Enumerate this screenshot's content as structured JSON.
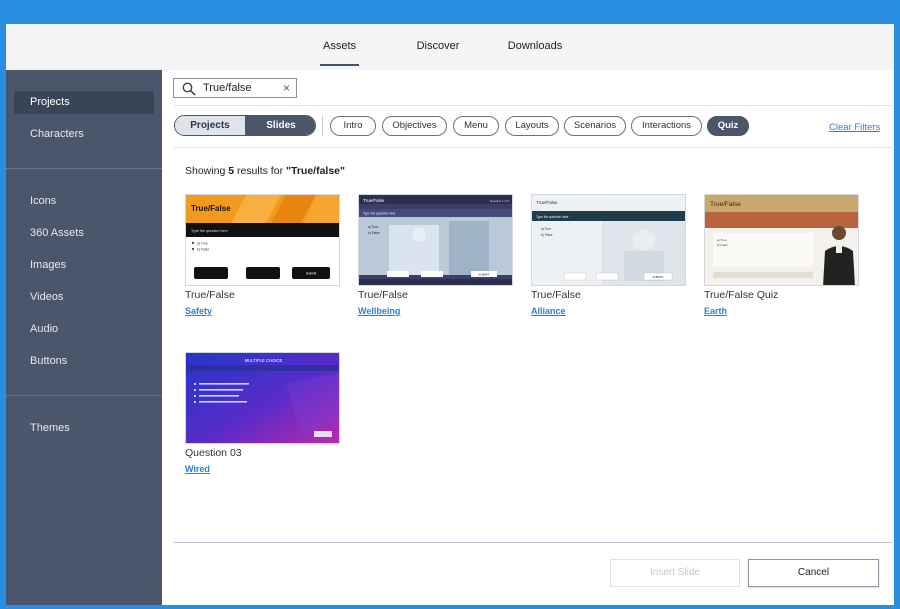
{
  "top_tabs": [
    {
      "label": "Assets",
      "active": true
    },
    {
      "label": "Discover",
      "active": false
    },
    {
      "label": "Downloads",
      "active": false
    }
  ],
  "sidebar": {
    "group1": [
      "Projects",
      "Characters"
    ],
    "group2": [
      "Icons",
      "360 Assets",
      "Images",
      "Videos",
      "Audio",
      "Buttons"
    ],
    "group3": [
      "Themes"
    ],
    "active": "Projects"
  },
  "search": {
    "value": "True/false",
    "icon": "search-icon",
    "clear_icon": "close-icon"
  },
  "segment": {
    "projects": "Projects",
    "slides": "Slides",
    "selected": "Slides"
  },
  "filters": [
    {
      "label": "Intro",
      "active": false
    },
    {
      "label": "Objectives",
      "active": false
    },
    {
      "label": "Menu",
      "active": false
    },
    {
      "label": "Layouts",
      "active": false
    },
    {
      "label": "Scenarios",
      "active": false
    },
    {
      "label": "Interactions",
      "active": false
    },
    {
      "label": "Quiz",
      "active": true
    }
  ],
  "clear_filters": "Clear Filters",
  "results": {
    "prefix": "Showing",
    "count": "5",
    "middle": "results for",
    "query": "\"True/false\""
  },
  "cards": [
    {
      "title": "True/False",
      "link": "Safety",
      "thumb": {
        "heading": "True/False",
        "question": "Type the question here",
        "options": [
          "a) True",
          "b) False"
        ],
        "submit": "Submit"
      }
    },
    {
      "title": "True/False",
      "link": "Wellbeing",
      "thumb": {
        "heading": "True/False",
        "counter": "Question 1 of 5",
        "question": "Type the question here",
        "options": [
          "a) True",
          "b) False"
        ],
        "submit": "SUBMIT"
      }
    },
    {
      "title": "True/False",
      "link": "Alliance",
      "thumb": {
        "heading": "True/False",
        "question": "Type the question here",
        "options": [
          "a) True",
          "b) False"
        ],
        "submit": "SUBMIT"
      }
    },
    {
      "title": "True/False Quiz",
      "link": "Earth",
      "thumb": {
        "heading": "True/False",
        "options": [
          "a) True",
          "b) False"
        ]
      }
    },
    {
      "title": "Question 03",
      "link": "Wired",
      "thumb": {
        "heading": "MULTIPLE CHOICE"
      }
    }
  ],
  "buttons": {
    "insert": "Insert Slide",
    "cancel": "Cancel"
  },
  "colors": {
    "sidebar": "#4b566b",
    "accent_link": "#2a7fd6",
    "outer": "#2a8ee0"
  }
}
